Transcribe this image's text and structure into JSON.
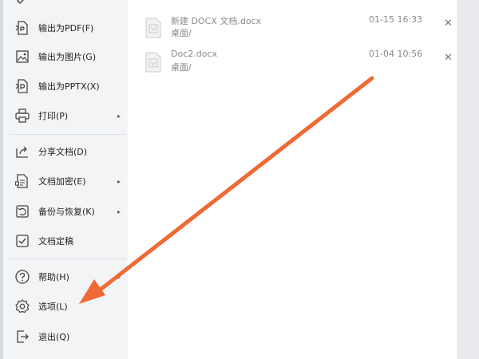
{
  "menu": {
    "items": [
      {
        "label": "输出为PDF(F)",
        "icon": "pdf-export-icon"
      },
      {
        "label": "输出为图片(G)",
        "icon": "image-export-icon"
      },
      {
        "label": "输出为PPTX(X)",
        "icon": "pptx-export-icon"
      },
      {
        "label": "打印(P)",
        "icon": "printer-icon",
        "submenu": true
      },
      {
        "label": "分享文档(D)",
        "icon": "share-icon"
      },
      {
        "label": "文档加密(E)",
        "icon": "encrypt-icon",
        "submenu": true
      },
      {
        "label": "备份与恢复(K)",
        "icon": "backup-icon",
        "submenu": true
      },
      {
        "label": "文档定稿",
        "icon": "finalize-icon"
      },
      {
        "label": "帮助(H)",
        "icon": "help-icon",
        "submenu": true
      },
      {
        "label": "选项(L)",
        "icon": "gear-icon"
      },
      {
        "label": "退出(Q)",
        "icon": "exit-icon"
      }
    ],
    "submenu_arrow": "▸"
  },
  "recent_files": [
    {
      "name": "新建 DOCX 文档.docx",
      "path": "桌面/",
      "date": "01-15 16:33",
      "close": "✕"
    },
    {
      "name": "Doc2.docx",
      "path": "桌面/",
      "date": "01-04 10:56",
      "close": "✕"
    }
  ],
  "annotation": {
    "color": "#f06a35",
    "icon": "arrow-pointer-icon"
  }
}
